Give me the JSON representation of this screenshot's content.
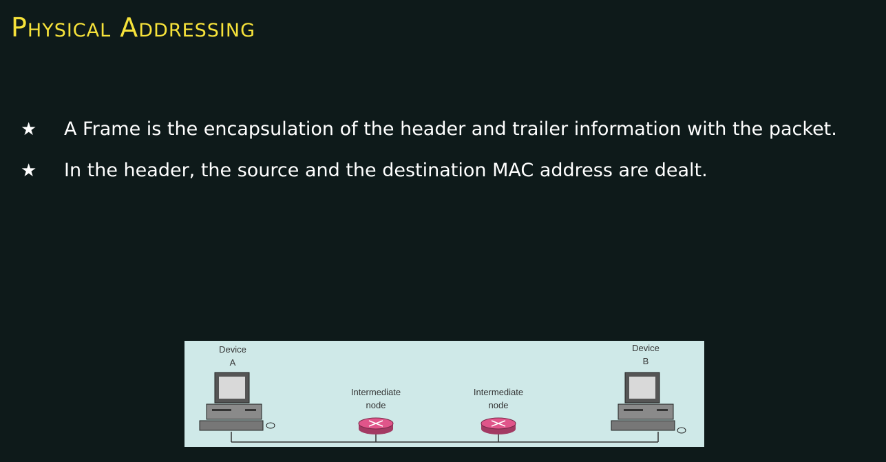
{
  "slide": {
    "title": "Physical Addressing",
    "bullets": [
      {
        "text": "A Frame is the encapsulation of the header and trailer information with the packet."
      },
      {
        "text": "In the header, the source and the destination MAC address are dealt."
      }
    ]
  },
  "diagram": {
    "device_a": {
      "line1": "Device",
      "line2": "A"
    },
    "device_b": {
      "line1": "Device",
      "line2": "B"
    },
    "node_1": {
      "line1": "Intermediate",
      "line2": "node"
    },
    "node_2": {
      "line1": "Intermediate",
      "line2": "node"
    }
  },
  "colors": {
    "background": "#0e1a1a",
    "title": "#f6e23a",
    "text": "#ffffff",
    "diagram_bg": "#cfe9e8",
    "router": "#e0558a"
  }
}
